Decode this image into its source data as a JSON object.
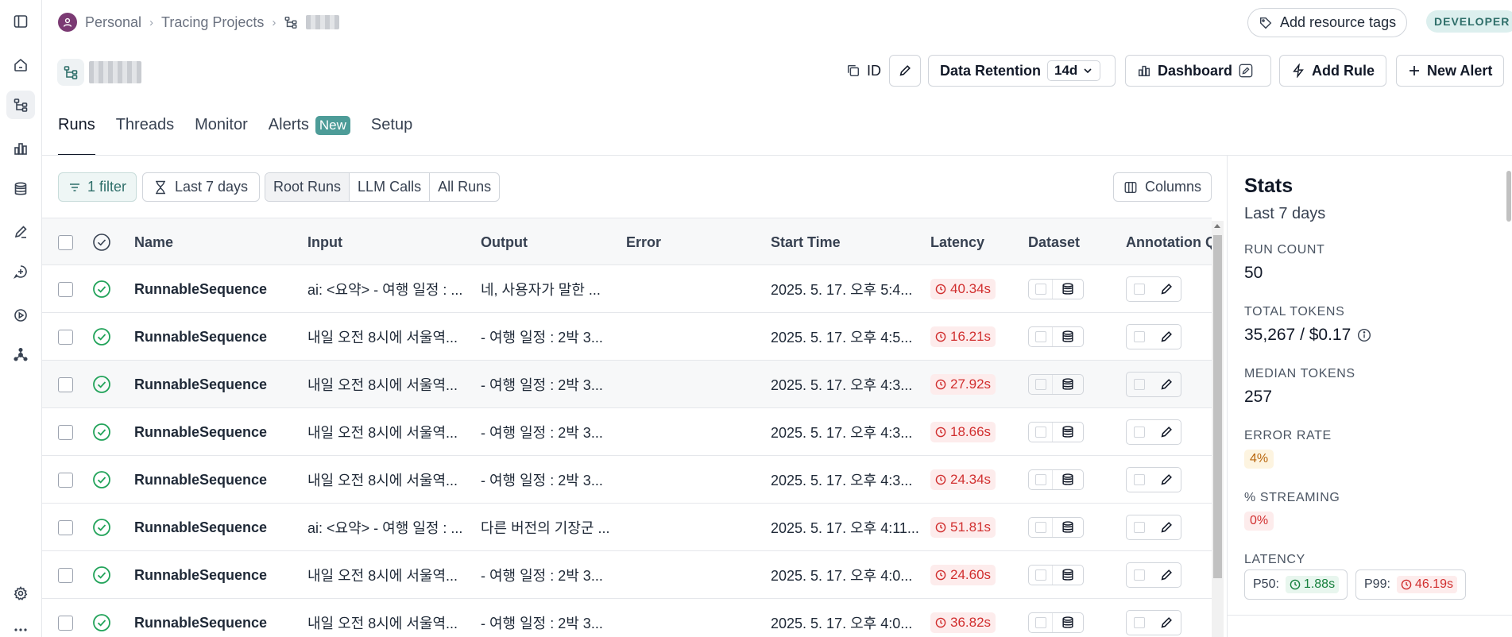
{
  "breadcrumb": {
    "workspace": "Personal",
    "section": "Tracing Projects"
  },
  "header": {
    "add_tags_label": "Add resource tags",
    "badge": "DEVELOPER",
    "id_label": "ID",
    "retention_label": "Data Retention",
    "retention_value": "14d",
    "dashboard_label": "Dashboard",
    "add_rule_label": "Add Rule",
    "new_alert_label": "New Alert"
  },
  "tabs": [
    {
      "label": "Runs",
      "active": true
    },
    {
      "label": "Threads"
    },
    {
      "label": "Monitor"
    },
    {
      "label": "Alerts",
      "badge": "New"
    },
    {
      "label": "Setup"
    }
  ],
  "toolbar": {
    "filter_label": "1 filter",
    "range_label": "Last 7 days",
    "run_types": [
      "Root Runs",
      "LLM Calls",
      "All Runs"
    ],
    "columns_label": "Columns"
  },
  "table": {
    "columns": [
      "Name",
      "Input",
      "Output",
      "Error",
      "Start Time",
      "Latency",
      "Dataset",
      "Annotation Q"
    ],
    "rows": [
      {
        "name": "RunnableSequence",
        "input": "ai: <요약> - 여행 일정 : ...",
        "output": "네, 사용자가 말한 ...",
        "error": "",
        "start": "2025. 5. 17. 오후 5:4...",
        "latency": "40.34s"
      },
      {
        "name": "RunnableSequence",
        "input": "내일 오전 8시에 서울역...",
        "output": "- 여행 일정 : 2박 3...",
        "error": "",
        "start": "2025. 5. 17. 오후 4:5...",
        "latency": "16.21s"
      },
      {
        "name": "RunnableSequence",
        "input": "내일 오전 8시에 서울역...",
        "output": "- 여행 일정 : 2박 3...",
        "error": "",
        "start": "2025. 5. 17. 오후 4:3...",
        "latency": "27.92s"
      },
      {
        "name": "RunnableSequence",
        "input": "내일 오전 8시에 서울역...",
        "output": "- 여행 일정 : 2박 3...",
        "error": "",
        "start": "2025. 5. 17. 오후 4:3...",
        "latency": "18.66s"
      },
      {
        "name": "RunnableSequence",
        "input": "내일 오전 8시에 서울역...",
        "output": "- 여행 일정 : 2박 3...",
        "error": "",
        "start": "2025. 5. 17. 오후 4:3...",
        "latency": "24.34s"
      },
      {
        "name": "RunnableSequence",
        "input": "ai: <요약> - 여행 일정 : ...",
        "output": "다른 버전의 기장군 ...",
        "error": "",
        "start": "2025. 5. 17. 오후 4:11...",
        "latency": "51.81s"
      },
      {
        "name": "RunnableSequence",
        "input": "내일 오전 8시에 서울역...",
        "output": "- 여행 일정 : 2박 3...",
        "error": "",
        "start": "2025. 5. 17. 오후 4:0...",
        "latency": "24.60s"
      },
      {
        "name": "RunnableSequence",
        "input": "내일 오전 8시에 서울역...",
        "output": "- 여행 일정 : 2박 3...",
        "error": "",
        "start": "2025. 5. 17. 오후 4:0...",
        "latency": "36.82s"
      }
    ]
  },
  "stats": {
    "title": "Stats",
    "range": "Last 7 days",
    "run_count_label": "RUN COUNT",
    "run_count": "50",
    "total_tokens_label": "TOTAL TOKENS",
    "total_tokens": "35,267 / $0.17",
    "median_tokens_label": "MEDIAN TOKENS",
    "median_tokens": "257",
    "error_rate_label": "ERROR RATE",
    "error_rate": "4%",
    "streaming_label": "% STREAMING",
    "streaming": "0%",
    "latency_label": "LATENCY",
    "p50_label": "P50:",
    "p50": "1.88s",
    "p99_label": "P99:",
    "p99": "46.19s"
  },
  "colors": {
    "accent": "#4d9c98",
    "success": "#22a35a",
    "error": "#d12f2f",
    "warning": "#b8650c",
    "avatar": "#7b3a73"
  },
  "icons": {
    "rail": [
      "sidebar-toggle-icon",
      "home-icon",
      "tracing-projects-icon",
      "monitoring-icon",
      "datasets-icon",
      "annotation-icon",
      "prompts-icon",
      "playground-icon",
      "deployments-icon",
      "settings-icon",
      "more-icon"
    ]
  }
}
